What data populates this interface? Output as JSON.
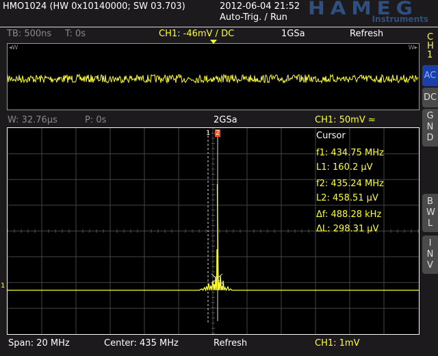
{
  "header": {
    "device": "HMO1024 (HW 0x10140000; SW 03.703)",
    "datetime": "2012-06-04 21:52",
    "trigger_mode": "Auto-Trig. / Run",
    "logo": "HAMEG",
    "logo_sub": "Instruments"
  },
  "status_top": {
    "timebase": "TB: 500ns",
    "time": "T: 0s",
    "channel": "CH1: -46mV / DC",
    "sample_rate": "1GSa",
    "mode": "Refresh"
  },
  "status_mid": {
    "window": "W: 32.76µs",
    "position": "P: 0s",
    "sample_rate": "2GSa",
    "channel": "CH1: 50mV ≈"
  },
  "side": {
    "channel": "CH1",
    "buttons": [
      {
        "label": "AC",
        "active": true
      },
      {
        "label": "DC"
      },
      {
        "label": "GND"
      },
      {
        "label": "BWL"
      },
      {
        "label": "INV"
      }
    ]
  },
  "cursor": {
    "title": "Cursor",
    "f1": "f1: 434.75 MHz",
    "l1": "L1: 160.2 µV",
    "f2": "f2: 435.24 MHz",
    "l2": "L2: 458.51 µV",
    "df": "Δf: 488.28 kHz",
    "dl": "ΔL: 298.31 µV"
  },
  "footer": {
    "span": "Span: 20 MHz",
    "center": "Center: 435 MHz",
    "mode": "Refresh",
    "channel": "CH1: 1mV"
  },
  "markers": {
    "ch_ref": "1",
    "cursor1": "1",
    "cursor2": "2",
    "w_left": "◂W",
    "w_right": "W▸"
  },
  "colors": {
    "trace": "#ffff33",
    "active_button": "#1a3fa8",
    "cursor_marker": "#ff4d1a"
  }
}
